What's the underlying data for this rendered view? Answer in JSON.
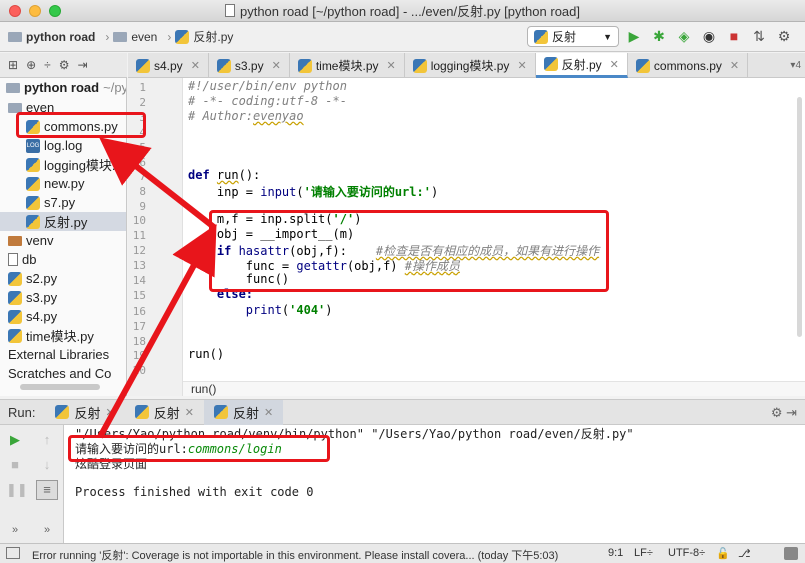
{
  "window": {
    "title": "python road [~/python road] - .../even/反射.py [python road]"
  },
  "navbar": {
    "crumbs": [
      "python road",
      "even",
      "反射.py"
    ],
    "run_config": "反射"
  },
  "project": {
    "root_label": "python road",
    "root_path": "~/pyt",
    "items": [
      {
        "label": "even"
      },
      {
        "label": "commons.py"
      },
      {
        "label": "log.log"
      },
      {
        "label": "logging模块.p"
      },
      {
        "label": "new.py"
      },
      {
        "label": "s7.py"
      },
      {
        "label": "反射.py"
      },
      {
        "label": "venv"
      },
      {
        "label": "db"
      },
      {
        "label": "s2.py"
      },
      {
        "label": "s3.py"
      },
      {
        "label": "s4.py"
      },
      {
        "label": "time模块.py"
      },
      {
        "label": "External Libraries"
      },
      {
        "label": "Scratches and Co"
      }
    ]
  },
  "tabs": [
    {
      "label": "s4.py"
    },
    {
      "label": "s3.py"
    },
    {
      "label": "time模块.py"
    },
    {
      "label": "logging模块.py"
    },
    {
      "label": "反射.py"
    },
    {
      "label": "commons.py"
    }
  ],
  "tabs_more": "4",
  "editor": {
    "line_numbers": [
      "1",
      "2",
      "3",
      "4",
      "5",
      "6",
      "7",
      "8",
      "9",
      "10",
      "11",
      "12",
      "13",
      "14",
      "15",
      "16",
      "17",
      "18",
      "19",
      "20"
    ],
    "shebang": "#!/user/bin/env python",
    "coding": "# -*- coding:utf-8 -*-",
    "author_prefix": "# Author:",
    "author_name": "evenyao",
    "def_kw": "def",
    "func_name": "run",
    "def_rest": "():",
    "inp_line_a": "    inp = ",
    "input_fn": "input",
    "inp_str": "'请输入要访问的url:'",
    "inp_line_b": ")",
    "split_line_a": "    m,f = inp.split(",
    "split_str": "'/'",
    "split_line_b": ")",
    "import_line": "    obj = __import__(m)",
    "if_kw": "    if ",
    "hasattr_fn": "hasattr",
    "hasattr_rest": "(obj,f):",
    "hasattr_comment": "#检查是否有相应的成员，如果有进行操作",
    "getattr_a": "        func = ",
    "getattr_fn": "getattr",
    "getattr_rest": "(obj,f) ",
    "getattr_comment": "#操作成员",
    "call_line": "        func()",
    "else_kw": "    else:",
    "print_a": "        ",
    "print_fn": "print",
    "print_str": "'404'",
    "print_b": ")",
    "run_call": "run()"
  },
  "editor_breadcrumb": "run()",
  "run_panel": {
    "label": "Run:",
    "tabs": [
      {
        "label": "反射"
      },
      {
        "label": "反射"
      },
      {
        "label": "反射"
      }
    ]
  },
  "console": {
    "command": "\"/Users/Yao/python road/venv/bin/python\" \"/Users/Yao/python road/even/反射.py\"",
    "prompt": "请输入要访问的url:",
    "user_input": "commons/login",
    "output": "炫酷登录页面",
    "finish": "Process finished with exit code 0"
  },
  "status": {
    "message": "Error running '反射': Coverage is not importable in this environment. Please install covera... (today 下午5:03)",
    "position": "9:1",
    "line_sep": "LF÷",
    "encoding": "UTF-8÷"
  },
  "colors": {
    "annotation_red": "#e8151b",
    "accent_blue": "#4a88c7"
  }
}
